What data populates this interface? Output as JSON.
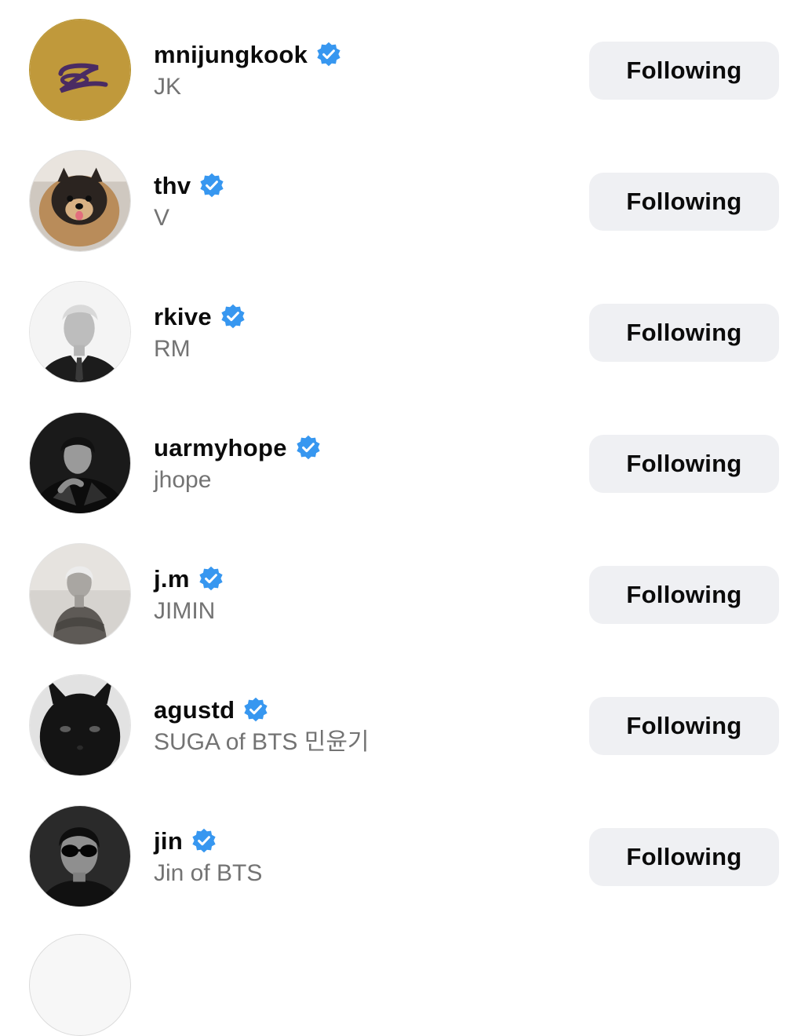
{
  "accent": {
    "verified": "#3797f0",
    "button_bg": "#eff0f3",
    "secondary_text": "#737373"
  },
  "following_list": [
    {
      "username": "mnijungkook",
      "full_name": "JK",
      "verified": true,
      "button_label": "Following",
      "avatar": "gold-logo-avatar"
    },
    {
      "username": "thv",
      "full_name": "V",
      "verified": true,
      "button_label": "Following",
      "avatar": "pomeranian-dog-avatar"
    },
    {
      "username": "rkive",
      "full_name": "RM",
      "verified": true,
      "button_label": "Following",
      "avatar": "suit-portrait-avatar"
    },
    {
      "username": "uarmyhope",
      "full_name": "jhope",
      "verified": true,
      "button_label": "Following",
      "avatar": "leather-jacket-portrait-avatar"
    },
    {
      "username": "j.m",
      "full_name": "JIMIN",
      "verified": true,
      "button_label": "Following",
      "avatar": "sweater-portrait-avatar"
    },
    {
      "username": "agustd",
      "full_name": "SUGA of BTS 민윤기",
      "verified": true,
      "button_label": "Following",
      "avatar": "black-cat-avatar"
    },
    {
      "username": "jin",
      "full_name": "Jin of BTS",
      "verified": true,
      "button_label": "Following",
      "avatar": "sunglasses-portrait-avatar"
    }
  ]
}
